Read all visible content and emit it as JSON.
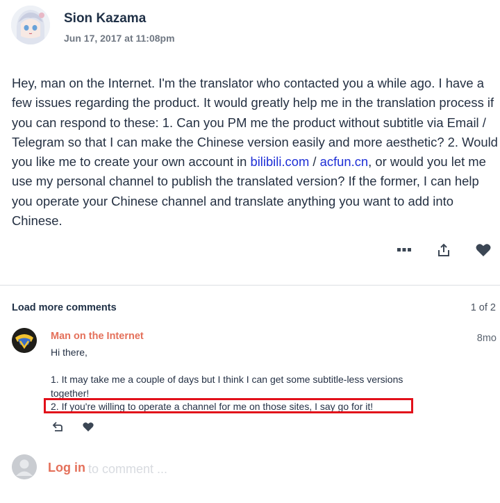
{
  "post": {
    "author": "Sion Kazama",
    "date": "Jun 17, 2017 at 11:08pm",
    "body_1": "Hey, man on the Internet. I'm the translator who contacted you a while ago. I have a few issues regarding the product. It would greatly help me in the translation process if you can respond to these: 1. Can you PM me the product without subtitle via Email / Telegram so that I can make the Chinese version easily and more aesthetic? 2. Would you like me to create your own account in ",
    "link_1": "bilibili.com",
    "body_2": " / ",
    "link_2": "acfun.cn",
    "body_3": ", or would you let me use my personal channel to publish the translated version? If the former, I can help you operate your Chinese channel and translate anything you want to add into Chinese.",
    "actions": [
      "more-icon",
      "share-icon",
      "heart-icon"
    ]
  },
  "comments_header": {
    "load_more": "Load more comments",
    "pager": "1 of 2"
  },
  "comment": {
    "author": "Man on the Internet",
    "time": "8mo",
    "line_1": "Hi there,",
    "line_2": "1. It may take me a couple of days but I think I can get some subtitle-less versions together!",
    "line_3": "2. If you're willing to operate a channel for me on those sites, I say go for it!",
    "actions": [
      "reply-icon",
      "heart-icon"
    ]
  },
  "login": {
    "link": "Log in",
    "placeholder": "to comment ..."
  },
  "colors": {
    "accent": "#e4705a",
    "link": "#1e2fd6",
    "highlight": "#e2101a",
    "text": "#243042"
  }
}
